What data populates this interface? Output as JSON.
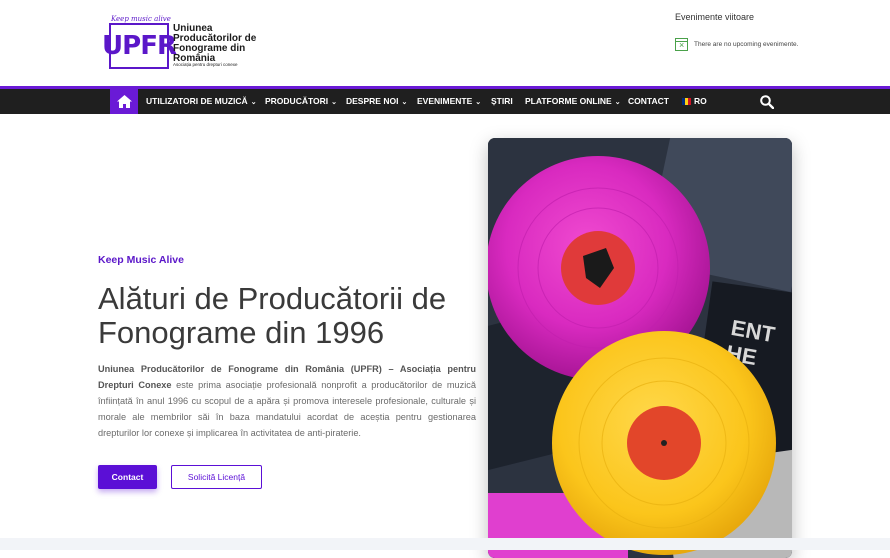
{
  "header": {
    "logo": {
      "tagline": "Keep music alive",
      "mark": "UPFR",
      "name": "Uniunea Producătorilor de Fonograme din România",
      "subtitle": "Asociația pentru drepturi conexe"
    },
    "events": {
      "title": "Evenimente viitoare",
      "empty_text": "There are no upcoming evenimente.",
      "icon": "calendar-x-icon"
    }
  },
  "nav": {
    "home_icon": "home-icon",
    "items": [
      {
        "label": "UTILIZATORI DE MUZICĂ",
        "has_dropdown": true
      },
      {
        "label": "PRODUCĂTORI",
        "has_dropdown": true
      },
      {
        "label": "DESPRE NOI",
        "has_dropdown": true
      },
      {
        "label": "EVENIMENTE",
        "has_dropdown": true
      },
      {
        "label": "ȘTIRI",
        "has_dropdown": false
      },
      {
        "label": "PLATFORME ONLINE",
        "has_dropdown": true
      },
      {
        "label": "CONTACT",
        "has_dropdown": false
      }
    ],
    "language": "RO",
    "search_icon": "search-icon",
    "colors": {
      "accent": "#6a1ad6",
      "bar": "#1f1f1f"
    }
  },
  "hero": {
    "tag": "Keep Music Alive",
    "title": "Alături de Producătorii de Fonograme din 1996",
    "text_bold": "Uniunea Producătorilor de Fonograme din România (UPFR) – Asociația pentru Drepturi Conexe",
    "text_rest": " este prima asociație profesională nonprofit a producătorilor de muzică înființată în anul 1996 cu scopul de a apăra și promova interesele profesionale, culturale și morale ale membrilor săi în baza mandatului acordat de aceștia pentru gestionarea drepturilor lor conexe și implicarea în activitatea de anti-piraterie.",
    "primary_button": "Contact",
    "secondary_button": "Solicită Licență",
    "image_alt": "vinyl-records-photo"
  }
}
